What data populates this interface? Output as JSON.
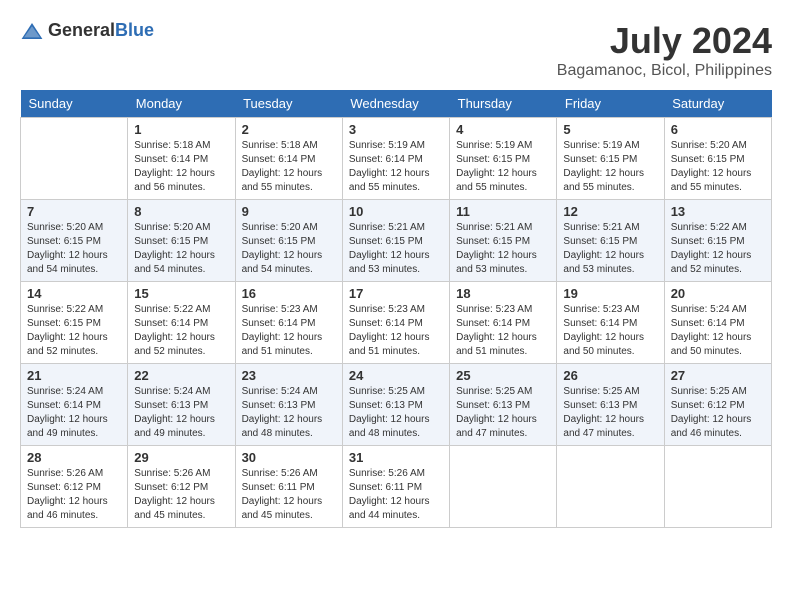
{
  "header": {
    "logo_general": "General",
    "logo_blue": "Blue",
    "month_year": "July 2024",
    "location": "Bagamanoc, Bicol, Philippines"
  },
  "calendar": {
    "days_of_week": [
      "Sunday",
      "Monday",
      "Tuesday",
      "Wednesday",
      "Thursday",
      "Friday",
      "Saturday"
    ],
    "weeks": [
      [
        {
          "day": "",
          "sunrise": "",
          "sunset": "",
          "daylight": ""
        },
        {
          "day": "1",
          "sunrise": "Sunrise: 5:18 AM",
          "sunset": "Sunset: 6:14 PM",
          "daylight": "Daylight: 12 hours and 56 minutes."
        },
        {
          "day": "2",
          "sunrise": "Sunrise: 5:18 AM",
          "sunset": "Sunset: 6:14 PM",
          "daylight": "Daylight: 12 hours and 55 minutes."
        },
        {
          "day": "3",
          "sunrise": "Sunrise: 5:19 AM",
          "sunset": "Sunset: 6:14 PM",
          "daylight": "Daylight: 12 hours and 55 minutes."
        },
        {
          "day": "4",
          "sunrise": "Sunrise: 5:19 AM",
          "sunset": "Sunset: 6:15 PM",
          "daylight": "Daylight: 12 hours and 55 minutes."
        },
        {
          "day": "5",
          "sunrise": "Sunrise: 5:19 AM",
          "sunset": "Sunset: 6:15 PM",
          "daylight": "Daylight: 12 hours and 55 minutes."
        },
        {
          "day": "6",
          "sunrise": "Sunrise: 5:20 AM",
          "sunset": "Sunset: 6:15 PM",
          "daylight": "Daylight: 12 hours and 55 minutes."
        }
      ],
      [
        {
          "day": "7",
          "sunrise": "Sunrise: 5:20 AM",
          "sunset": "Sunset: 6:15 PM",
          "daylight": "Daylight: 12 hours and 54 minutes."
        },
        {
          "day": "8",
          "sunrise": "Sunrise: 5:20 AM",
          "sunset": "Sunset: 6:15 PM",
          "daylight": "Daylight: 12 hours and 54 minutes."
        },
        {
          "day": "9",
          "sunrise": "Sunrise: 5:20 AM",
          "sunset": "Sunset: 6:15 PM",
          "daylight": "Daylight: 12 hours and 54 minutes."
        },
        {
          "day": "10",
          "sunrise": "Sunrise: 5:21 AM",
          "sunset": "Sunset: 6:15 PM",
          "daylight": "Daylight: 12 hours and 53 minutes."
        },
        {
          "day": "11",
          "sunrise": "Sunrise: 5:21 AM",
          "sunset": "Sunset: 6:15 PM",
          "daylight": "Daylight: 12 hours and 53 minutes."
        },
        {
          "day": "12",
          "sunrise": "Sunrise: 5:21 AM",
          "sunset": "Sunset: 6:15 PM",
          "daylight": "Daylight: 12 hours and 53 minutes."
        },
        {
          "day": "13",
          "sunrise": "Sunrise: 5:22 AM",
          "sunset": "Sunset: 6:15 PM",
          "daylight": "Daylight: 12 hours and 52 minutes."
        }
      ],
      [
        {
          "day": "14",
          "sunrise": "Sunrise: 5:22 AM",
          "sunset": "Sunset: 6:15 PM",
          "daylight": "Daylight: 12 hours and 52 minutes."
        },
        {
          "day": "15",
          "sunrise": "Sunrise: 5:22 AM",
          "sunset": "Sunset: 6:14 PM",
          "daylight": "Daylight: 12 hours and 52 minutes."
        },
        {
          "day": "16",
          "sunrise": "Sunrise: 5:23 AM",
          "sunset": "Sunset: 6:14 PM",
          "daylight": "Daylight: 12 hours and 51 minutes."
        },
        {
          "day": "17",
          "sunrise": "Sunrise: 5:23 AM",
          "sunset": "Sunset: 6:14 PM",
          "daylight": "Daylight: 12 hours and 51 minutes."
        },
        {
          "day": "18",
          "sunrise": "Sunrise: 5:23 AM",
          "sunset": "Sunset: 6:14 PM",
          "daylight": "Daylight: 12 hours and 51 minutes."
        },
        {
          "day": "19",
          "sunrise": "Sunrise: 5:23 AM",
          "sunset": "Sunset: 6:14 PM",
          "daylight": "Daylight: 12 hours and 50 minutes."
        },
        {
          "day": "20",
          "sunrise": "Sunrise: 5:24 AM",
          "sunset": "Sunset: 6:14 PM",
          "daylight": "Daylight: 12 hours and 50 minutes."
        }
      ],
      [
        {
          "day": "21",
          "sunrise": "Sunrise: 5:24 AM",
          "sunset": "Sunset: 6:14 PM",
          "daylight": "Daylight: 12 hours and 49 minutes."
        },
        {
          "day": "22",
          "sunrise": "Sunrise: 5:24 AM",
          "sunset": "Sunset: 6:13 PM",
          "daylight": "Daylight: 12 hours and 49 minutes."
        },
        {
          "day": "23",
          "sunrise": "Sunrise: 5:24 AM",
          "sunset": "Sunset: 6:13 PM",
          "daylight": "Daylight: 12 hours and 48 minutes."
        },
        {
          "day": "24",
          "sunrise": "Sunrise: 5:25 AM",
          "sunset": "Sunset: 6:13 PM",
          "daylight": "Daylight: 12 hours and 48 minutes."
        },
        {
          "day": "25",
          "sunrise": "Sunrise: 5:25 AM",
          "sunset": "Sunset: 6:13 PM",
          "daylight": "Daylight: 12 hours and 47 minutes."
        },
        {
          "day": "26",
          "sunrise": "Sunrise: 5:25 AM",
          "sunset": "Sunset: 6:13 PM",
          "daylight": "Daylight: 12 hours and 47 minutes."
        },
        {
          "day": "27",
          "sunrise": "Sunrise: 5:25 AM",
          "sunset": "Sunset: 6:12 PM",
          "daylight": "Daylight: 12 hours and 46 minutes."
        }
      ],
      [
        {
          "day": "28",
          "sunrise": "Sunrise: 5:26 AM",
          "sunset": "Sunset: 6:12 PM",
          "daylight": "Daylight: 12 hours and 46 minutes."
        },
        {
          "day": "29",
          "sunrise": "Sunrise: 5:26 AM",
          "sunset": "Sunset: 6:12 PM",
          "daylight": "Daylight: 12 hours and 45 minutes."
        },
        {
          "day": "30",
          "sunrise": "Sunrise: 5:26 AM",
          "sunset": "Sunset: 6:11 PM",
          "daylight": "Daylight: 12 hours and 45 minutes."
        },
        {
          "day": "31",
          "sunrise": "Sunrise: 5:26 AM",
          "sunset": "Sunset: 6:11 PM",
          "daylight": "Daylight: 12 hours and 44 minutes."
        },
        {
          "day": "",
          "sunrise": "",
          "sunset": "",
          "daylight": ""
        },
        {
          "day": "",
          "sunrise": "",
          "sunset": "",
          "daylight": ""
        },
        {
          "day": "",
          "sunrise": "",
          "sunset": "",
          "daylight": ""
        }
      ]
    ]
  }
}
